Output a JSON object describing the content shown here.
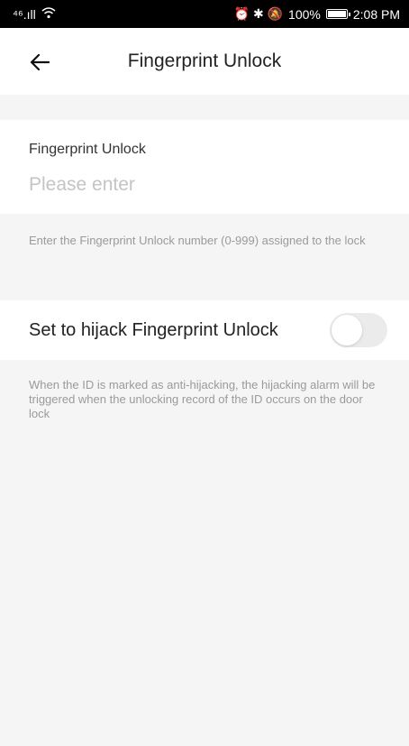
{
  "status_bar": {
    "network": "⁴⁶.ıll",
    "wifi": "wifi-icon",
    "indicators": "⏰ ✱ 🔕",
    "battery_percent": "100%",
    "battery_level": 1.0,
    "time": "2:08 PM"
  },
  "header": {
    "title": "Fingerprint Unlock"
  },
  "form": {
    "label": "Fingerprint Unlock",
    "placeholder": "Please enter",
    "value": ""
  },
  "hints": {
    "number_hint": "Enter the Fingerprint Unlock number (0-999) assigned to the lock",
    "hijack_hint": "When the ID is marked as anti-hijacking, the hijacking alarm will be triggered when the unlocking record of the ID occurs on the door lock"
  },
  "hijack": {
    "label": "Set to hijack Fingerprint Unlock",
    "enabled": false
  },
  "colors": {
    "accent_text": "#222222",
    "hint": "#9a9a9a",
    "toggle_off": "#ebebeb"
  }
}
